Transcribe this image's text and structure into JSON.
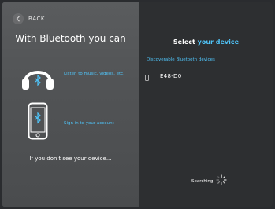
{
  "back": {
    "label": "BACK",
    "icon": "chevron-left-icon"
  },
  "left": {
    "title": "With Bluetooth you can",
    "features": [
      {
        "icon": "headphones-bluetooth-icon",
        "text": "Listen to music, videos, etc."
      },
      {
        "icon": "phone-bluetooth-icon",
        "text": "Sign in to your account"
      }
    ],
    "footer": "If you don't see your device..."
  },
  "right": {
    "title_prefix": "Select",
    "title_accent": "your device",
    "section_label": "Discoverable Bluetooth devices",
    "devices": [
      {
        "icon": "phone-icon",
        "name": "E48-D0"
      }
    ],
    "status": "Searching",
    "status_icon": "spinner-icon"
  },
  "colors": {
    "accent": "#4fc3f7",
    "left_panel": "#555759",
    "right_panel": "#2d2f31"
  }
}
